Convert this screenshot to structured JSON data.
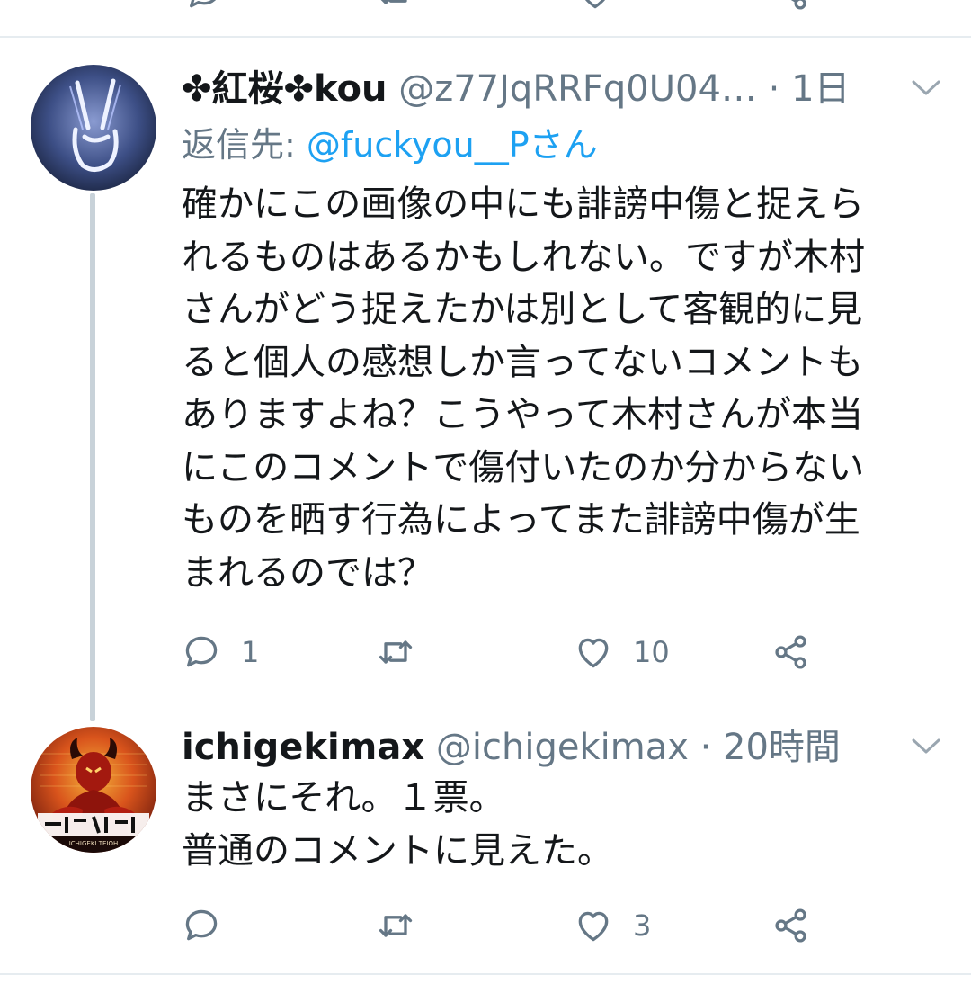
{
  "colors": {
    "text": "#14171a",
    "secondary": "#657786",
    "link": "#1da1f2",
    "divider": "#e6ecf0",
    "thread_line": "#c8d2d9"
  },
  "tweets": [
    {
      "name": "✤紅桜✤kou",
      "handle": "@z77JqRRFq0U04…",
      "separator": "·",
      "time": "1日",
      "reply_label": "返信先: ",
      "reply_mention": "@fuckyou__Pさん",
      "text_lines": [
        "確かにこの画像の中にも誹謗中傷と捉えら",
        "れるものはあるかもしれない。ですが木村",
        "さんがどう捉えたかは別として客観的に見",
        "ると個人の感想しか言ってないコメントも",
        "ありますよね？こうやって木村さんが本当",
        "にこのコメントで傷付いたのか分からない",
        "ものを晒す行為によってまた誹謗中傷が生",
        "まれるのでは？"
      ],
      "reply_count": "1",
      "retweet_count": "",
      "like_count": "10",
      "icons": [
        "reply-icon",
        "retweet-icon",
        "like-icon",
        "share-icon",
        "caret-down-icon"
      ]
    },
    {
      "name": "ichigekimax",
      "handle": "@ichigekimax",
      "separator": "·",
      "time": "20時間",
      "text_lines": [
        "まさにそれ。１票。",
        "普通のコメントに見えた。"
      ],
      "reply_count": "",
      "retweet_count": "",
      "like_count": "3",
      "avatar_text": "ICHIGEKI TEIOH",
      "icons": [
        "reply-icon",
        "retweet-icon",
        "like-icon",
        "share-icon",
        "caret-down-icon"
      ]
    }
  ]
}
